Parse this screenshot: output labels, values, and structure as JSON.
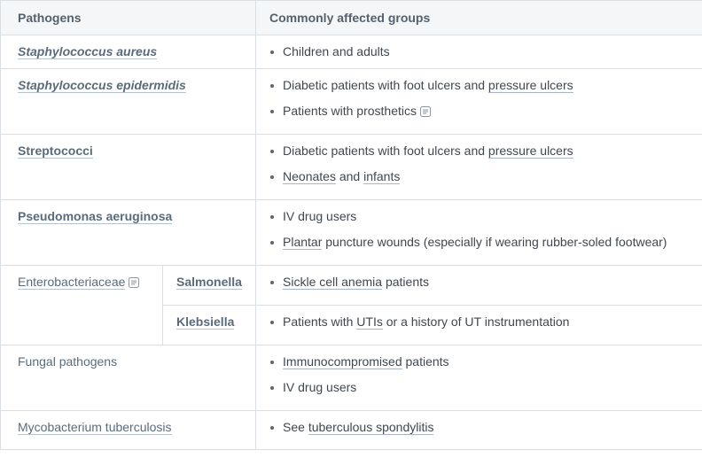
{
  "header": {
    "pathogens": "Pathogens",
    "groups": "Commonly affected groups"
  },
  "rows": {
    "staph_aureus": {
      "name": "Staphylococcus aureus",
      "groups": [
        "Children and adults"
      ]
    },
    "staph_epi": {
      "name": "Staphylococcus epidermidis",
      "g1a": "Diabetic patients with foot ulcers and ",
      "g1b": "pressure ulcers",
      "g2": "Patients with prosthetics"
    },
    "strep": {
      "name": "Streptococci",
      "g1a": "Diabetic patients with foot ulcers and ",
      "g1b": "pressure ulcers",
      "g2a": "Neonates",
      "g2b": " and ",
      "g2c": "infants"
    },
    "pseudo": {
      "name": "Pseudomonas aeruginosa",
      "g1": "IV drug users",
      "g2a": "Plantar",
      "g2b": " puncture wounds (especially if wearing rubber-soled footwear)"
    },
    "entero": {
      "name": "Enterobacteriaceae",
      "salmonella": "Salmonella",
      "sal_a": "Sickle cell anemia",
      "sal_b": " patients",
      "klebsiella": "Klebsiella",
      "kle_a": "Patients with ",
      "kle_b": "UTIs",
      "kle_c": " or a history of UT instrumentation"
    },
    "fungal": {
      "name": "Fungal pathogens",
      "g1a": "Immunocompromised",
      "g1b": " patients",
      "g2": "IV drug users"
    },
    "myco": {
      "name": "Mycobacterium tuberculosis",
      "g1a": "See ",
      "g1b": "tuberculous spondylitis"
    }
  }
}
